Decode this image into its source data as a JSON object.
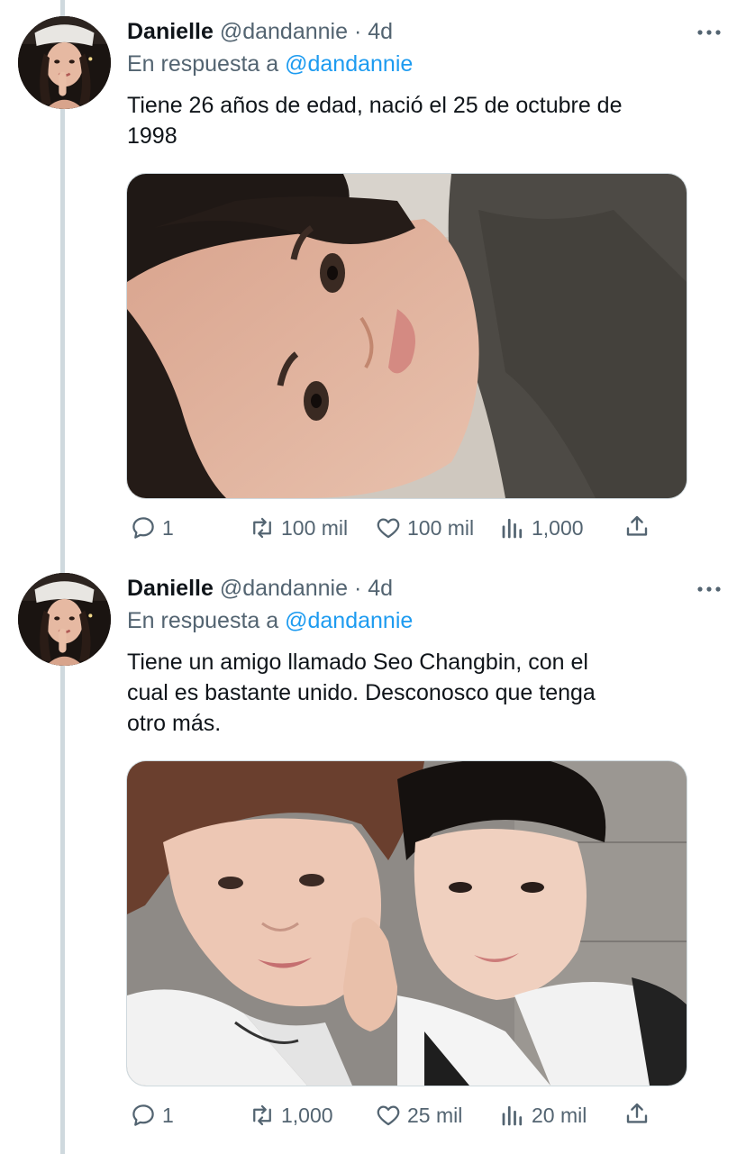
{
  "colors": {
    "text": "#0f1419",
    "secondary": "#536471",
    "link": "#1d9bf0",
    "thread_line": "#cfd9de"
  },
  "tweets": [
    {
      "author_name": "Danielle",
      "author_handle": "@dandannie",
      "separator": "·",
      "time": "4d",
      "reply_prefix": "En respuesta a",
      "reply_mention": "@dandannie",
      "text": "Tiene 26 años de edad, nació el 25 de octubre de\n1998",
      "media_icon": "photo-selfie",
      "stats": {
        "replies": "1",
        "retweets": "100 mil",
        "likes": "100 mil",
        "views": "1,000"
      },
      "icons": {
        "reply": "comment-icon",
        "retweet": "retweet-icon",
        "like": "heart-icon",
        "views": "bar-chart-icon",
        "share": "share-icon",
        "more": "more-icon"
      }
    },
    {
      "author_name": "Danielle",
      "author_handle": "@dandannie",
      "separator": "·",
      "time": "4d",
      "reply_prefix": "En respuesta a",
      "reply_mention": "@dandannie",
      "text": "Tiene un amigo llamado Seo Changbin, con el\ncual es bastante unido. Desconosco que tenga\notro más.",
      "media_icon": "photo-two-people",
      "stats": {
        "replies": "1",
        "retweets": "1,000",
        "likes": "25 mil",
        "views": "20 mil"
      },
      "icons": {
        "reply": "comment-icon",
        "retweet": "retweet-icon",
        "like": "heart-icon",
        "views": "bar-chart-icon",
        "share": "share-icon",
        "more": "more-icon"
      }
    }
  ]
}
